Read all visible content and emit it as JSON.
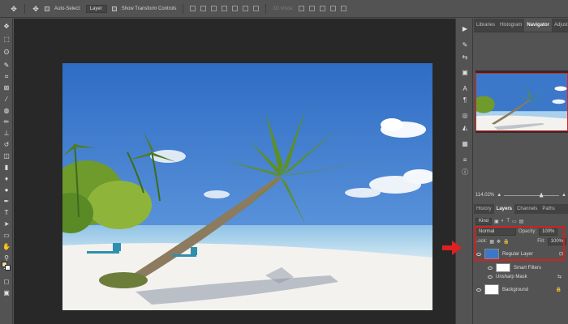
{
  "options_bar": {
    "move_tool_icon": "move-icon",
    "auto_select_label": "Auto-Select:",
    "auto_select_value": "Layer",
    "show_transform_label": "Show Transform Controls",
    "mode_label": "3D Mode:"
  },
  "toolbar": {
    "tools": [
      "move-icon",
      "marquee-icon",
      "lasso-icon",
      "quick-select-icon",
      "crop-icon",
      "frame-icon",
      "eyedropper-icon",
      "healing-icon",
      "brush-icon",
      "stamp-icon",
      "history-brush-icon",
      "eraser-icon",
      "gradient-icon",
      "blur-icon",
      "dodge-icon",
      "pen-icon",
      "type-icon",
      "path-select-icon",
      "shape-icon",
      "hand-icon",
      "zoom-icon"
    ],
    "foreground_color": "#e8dc9a",
    "background_color": "#f2f2f2"
  },
  "right_strip": {
    "icons": [
      "play-icon",
      "brush-settings-icon",
      "adjust-icon",
      "glyph-icon",
      "character-icon",
      "paragraph-icon",
      "styles-icon",
      "shapes-icon",
      "swatches-icon",
      "properties-icon",
      "info-icon"
    ]
  },
  "panel": {
    "top_tabs": [
      "Libraries",
      "Histogram",
      "Navigator",
      "Adjustm"
    ],
    "active_top_tab": "Navigator",
    "zoom": "114.02%",
    "layer_tabs": [
      "History",
      "Layers",
      "Channels",
      "Paths"
    ],
    "active_layer_tab": "Layers",
    "kind_label": "Kind",
    "blend_mode": "Normal",
    "opacity_label": "Opacity:",
    "opacity_value": "100%",
    "lock_label": "Lock:",
    "fill_label": "Fill:",
    "fill_value": "100%",
    "layers": [
      {
        "name": "Regular Layer"
      },
      {
        "name": "Smart Filters"
      },
      {
        "name": "Unsharp Mask"
      },
      {
        "name": "Background"
      }
    ]
  },
  "accent": {
    "highlight": "#d21f1f",
    "sky": "#3b78c9"
  }
}
